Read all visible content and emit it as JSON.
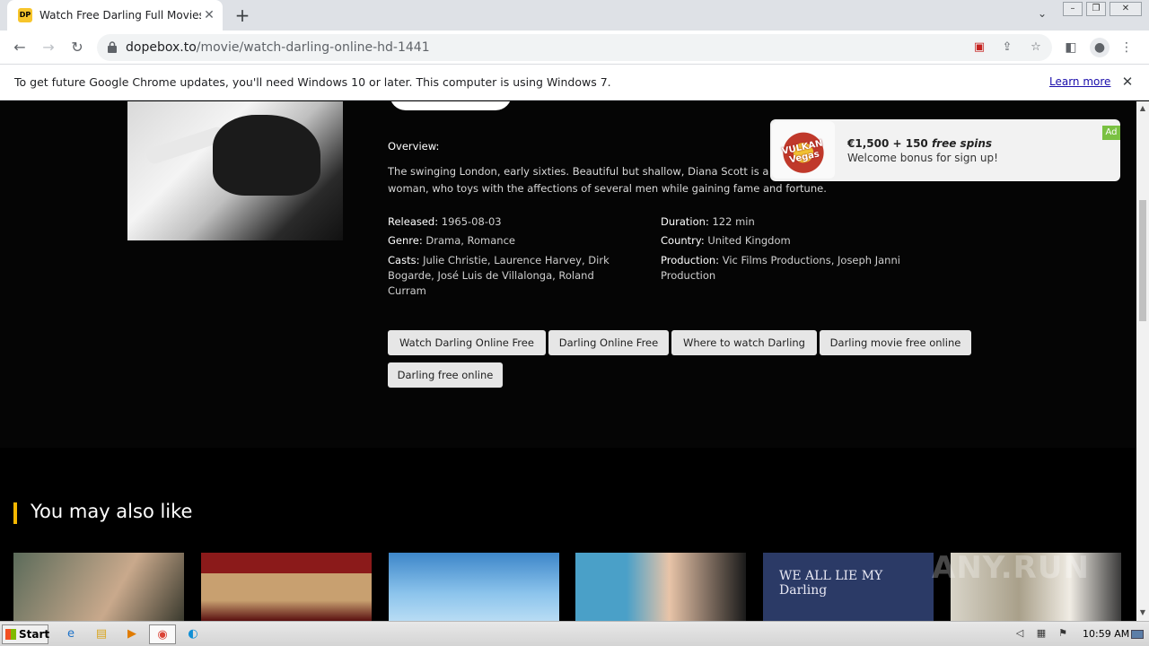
{
  "browser": {
    "tab_title": "Watch Free Darling Full Movies Onlin",
    "favicon_text": "DP",
    "tab_close": "✕",
    "new_tab": "+",
    "url_host": "dopebox.to",
    "url_path": "/movie/watch-darling-online-hd-1441"
  },
  "infobar": {
    "message": "To get future Google Chrome updates, you'll need Windows 10 or later. This computer is using Windows 7.",
    "link": "Learn more",
    "close": "✕"
  },
  "movie": {
    "overview_label": "Overview:",
    "overview": "The swinging London, early sixties. Beautiful but shallow, Diana Scott is a model and actress, a vocationally bored woman, who toys with the affections of several men while gaining fame and fortune.",
    "released_label": "Released:",
    "released": "1965-08-03",
    "genre_label": "Genre:",
    "genre": "Drama, Romance",
    "casts_label": "Casts:",
    "casts": "Julie Christie, Laurence Harvey, Dirk Bogarde, José Luis de Villalonga, Roland Curram",
    "duration_label": "Duration:",
    "duration": "122 min",
    "country_label": "Country:",
    "country": "United Kingdom",
    "production_label": "Production:",
    "production": "Vic Films Productions, Joseph Janni Production",
    "tags": [
      "Watch Darling Online Free",
      "Darling Online Free",
      "Where to watch Darling",
      "Darling movie free online",
      "Darling free online"
    ]
  },
  "related": {
    "title": "You may also like",
    "thumb_text": "WE ALL LIE MY Darling"
  },
  "ad": {
    "logo_text": "VULKAN Vegas",
    "title_prefix": "€1,500 + 150 ",
    "title_emphasis": "free spins",
    "subtitle": "Welcome bonus for sign up!",
    "badge": "Ad"
  },
  "taskbar": {
    "start": "Start",
    "clock": "10:59 AM"
  },
  "watermark": "ANY.RUN",
  "colors": {
    "accent": "#f5b700",
    "tag_bg": "#e6e6e6",
    "ad_badge": "#7ac142"
  }
}
